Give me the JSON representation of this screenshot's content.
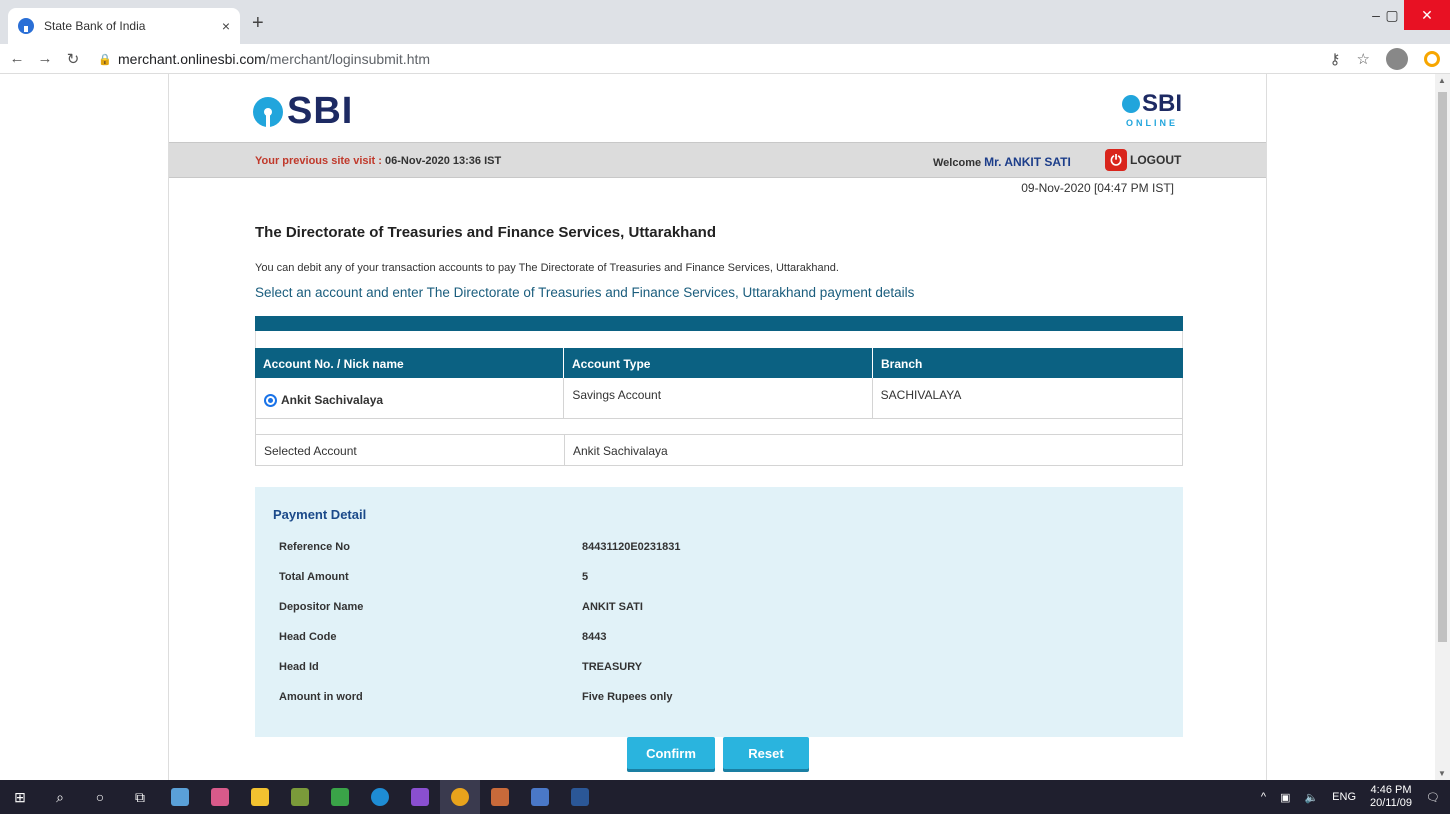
{
  "browser": {
    "tab_title": "State Bank of India",
    "tab_close": "×",
    "new_tab": "+",
    "url_host": "merchant.onlinesbi.com",
    "url_path": "/merchant/loginsubmit.htm",
    "win_min": "–",
    "win_max": "▢",
    "win_close": "✕"
  },
  "header": {
    "logo_text": "SBI",
    "online_logo_text": "SBI",
    "online_logo_sub": "ONLINE",
    "prev_visit_label": "Your previous site visit :",
    "prev_visit_value": "06-Nov-2020 13:36 IST",
    "welcome_label": "Welcome",
    "welcome_name": "Mr. ANKIT SATI",
    "logout_label": "LOGOUT",
    "datetime": "09-Nov-2020 [04:47 PM IST]"
  },
  "main": {
    "heading": "The Directorate of Treasuries and Finance Services, Uttarakhand",
    "description": "You can debit any of your transaction accounts to pay The Directorate of Treasuries and Finance Services, Uttarakhand.",
    "instruction": "Select an account and enter The Directorate of Treasuries and Finance Services, Uttarakhand payment details"
  },
  "accounts_table": {
    "columns": [
      "Account No. / Nick name",
      "Account Type",
      "Branch"
    ],
    "rows": [
      [
        "Ankit Sachivalaya",
        "Savings Account",
        "SACHIVALAYA"
      ]
    ],
    "selected_label": "Selected Account",
    "selected_value": "Ankit Sachivalaya"
  },
  "payment_detail": {
    "title": "Payment Detail",
    "fields": [
      {
        "label": "Reference No",
        "value": "84431120E0231831"
      },
      {
        "label": "Total Amount",
        "value": "5"
      },
      {
        "label": "Depositor Name",
        "value": "ANKIT SATI"
      },
      {
        "label": "Head Code",
        "value": "8443"
      },
      {
        "label": "Head Id",
        "value": "TREASURY"
      },
      {
        "label": "Amount in word",
        "value": "Five Rupees only"
      }
    ]
  },
  "actions": {
    "confirm_label": "Confirm",
    "reset_label": "Reset"
  },
  "taskbar": {
    "lang": "ENG",
    "time": "4:46 PM",
    "date": "20/11/09"
  },
  "colors": {
    "table_header": "#0b6182",
    "button": "#2ab4de",
    "payment_box": "#e1f2f8",
    "prev_visit": "#c0392b"
  }
}
